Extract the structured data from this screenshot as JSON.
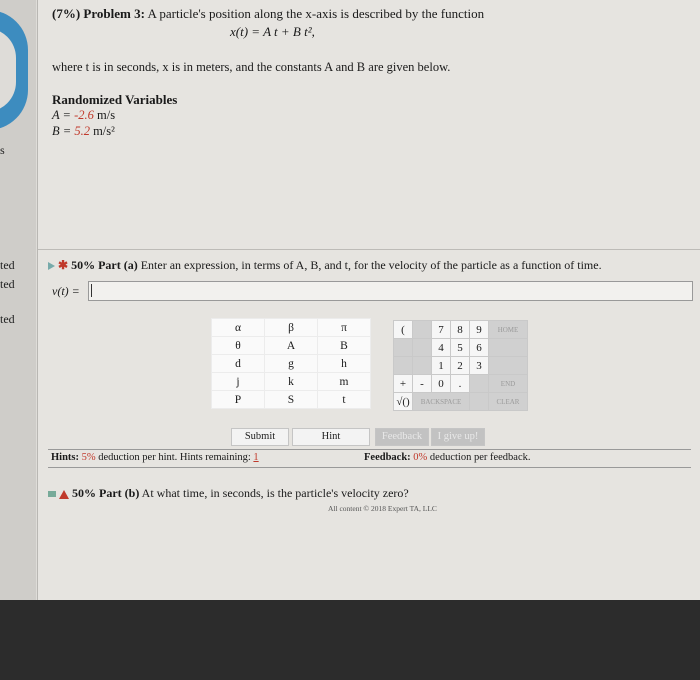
{
  "sidebar": {
    "labels": [
      "s",
      "ted",
      "ted",
      "ted"
    ]
  },
  "problem": {
    "title_bold": "(7%) Problem 3:",
    "title_text": " A particle's position along the x-axis is described by the function",
    "equation": "x(t) = A t + B t²,",
    "description": "where t is in seconds, x is in meters, and the constants A and B are given below.",
    "rv_title": "Randomized Variables",
    "a_label": "A = ",
    "a_value": "-2.6",
    "a_unit": " m/s",
    "b_label": "B = ",
    "b_value": "5.2",
    "b_unit": " m/s²"
  },
  "part_a": {
    "percent": "50% Part (a)",
    "text": " Enter an expression, in terms of A, B, and t, for the velocity of the particle as a function of time.",
    "answer_label": "v(t) = "
  },
  "keypad": {
    "rows": [
      [
        "α",
        "β",
        "π"
      ],
      [
        "θ",
        "A",
        "B"
      ],
      [
        "d",
        "g",
        "h"
      ],
      [
        "j",
        "k",
        "m"
      ],
      [
        "P",
        "S",
        "t"
      ]
    ]
  },
  "numpad": {
    "rows": [
      [
        "(",
        "",
        "7",
        "8",
        "9",
        "HOME"
      ],
      [
        "",
        "",
        "4",
        "5",
        "6",
        ""
      ],
      [
        "",
        "",
        "1",
        "2",
        "3",
        ""
      ],
      [
        "+",
        "-",
        "0",
        ".",
        "",
        "END"
      ],
      [
        "√()",
        "BACKSPACE",
        "",
        "",
        "",
        "CLEAR"
      ]
    ]
  },
  "buttons": {
    "submit": "Submit",
    "hint": "Hint",
    "feedback": "Feedback",
    "giveup": "I give up!"
  },
  "hints": {
    "label": "Hints:",
    "percent": "5%",
    "text": " deduction per hint. Hints remaining: ",
    "remaining": "1"
  },
  "feedback": {
    "label": "Feedback:",
    "percent": "0%",
    "text": " deduction per feedback."
  },
  "part_b": {
    "percent": "50% Part (b)",
    "text": " At what time, in seconds, is the particle's velocity zero?"
  },
  "footer": {
    "copyright": "All content © 2018 Expert TA, LLC"
  }
}
